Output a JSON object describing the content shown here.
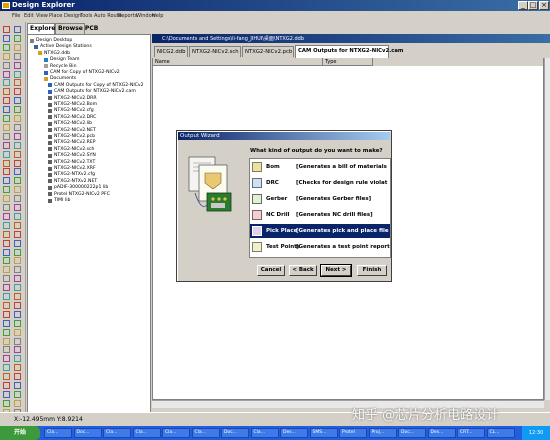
{
  "window": {
    "title": "Design Explorer"
  },
  "menu": [
    "File",
    "Edit",
    "View",
    "Place",
    "Design",
    "Tools",
    "Auto Route",
    "Reports",
    "Window",
    "Help"
  ],
  "explorer": {
    "tabs": [
      "Explorer",
      "Browse PCB"
    ],
    "tree": [
      "Design Desktop",
      "Active Design Stations",
      "NTXG2.ddb",
      "Design Team",
      "Recycle Bin",
      "CAM for Copy of NTXG2-NICv2",
      "Documents",
      "CAM Outputs for Copy of NTXG2-NICv2",
      "CAM Outputs for NTXG2-NICv2.cam",
      "NTXG2-NICv2.DRR",
      "NTXG2-NICv2.Bom",
      "NTXG2-NICv2.cfg",
      "NTXG2-NICv2.DRC",
      "NTXG2-NICv2.lib",
      "NTXG2-NICv2.NET",
      "NTXG2-NICv2.pcb",
      "NTXG2-NICv2.REP",
      "NTXG2-NICv2.sch",
      "NTXG2-NICv2.SYN",
      "NTXG2-NICv2.TXT",
      "NTXG2-NICv2.XRF",
      "NTXG2-NTXv2.cfg",
      "NTXG2-NTXv2.NET",
      "pADIF-300000222p1 lib",
      "Protel NTXG2-NICv2 PFC",
      "TIMI lib"
    ]
  },
  "document": {
    "path": "C:\\Documents and Settings\\li-fang_JIHUI\\桌面\\NTXG2.ddb",
    "tabs": [
      "NICG2.ddb",
      "NTXG2-NICv2.sch",
      "NTXG2-NICv2.pcb",
      "CAM Outputs for NTXG2-NICv2.cam"
    ],
    "columns": [
      "Name",
      "Type"
    ]
  },
  "dialog": {
    "title": "Output Wizard",
    "question": "What kind of output do you want to make?",
    "options": [
      {
        "label": "Bom",
        "desc": "[Generates a bill of materials",
        "icon_color": "#f0e0a0",
        "selected": false
      },
      {
        "label": "DRC",
        "desc": "[Checks for design rule violat",
        "icon_color": "#d0e0f0",
        "selected": false
      },
      {
        "label": "Gerber",
        "desc": "[Generates Gerber files]",
        "icon_color": "#e0f0d0",
        "selected": false
      },
      {
        "label": "NC Drill",
        "desc": "[Generates NC drill files]",
        "icon_color": "#f0d0d0",
        "selected": false
      },
      {
        "label": "Pick Place",
        "desc": "[Generates pick and place file",
        "icon_color": "#e0d0f0",
        "selected": true
      },
      {
        "label": "Test Points",
        "desc": "[Generates a test point report",
        "icon_color": "#f0f0d0",
        "selected": false
      }
    ],
    "buttons": {
      "cancel": "Cancel",
      "back": "< Back",
      "next": "Next >",
      "finish": "Finish"
    }
  },
  "status": {
    "coords": "X:-12.495mm Y:8.9214"
  },
  "taskbar": {
    "start": "开始",
    "items": [
      "Cla...",
      "Doc...",
      "Cla...",
      "Cla...",
      "Cla...",
      "Cla...",
      "Doc...",
      "Cla...",
      "Des...",
      "SMS...",
      "Protel",
      "Proj...",
      "Doc...",
      "Des...",
      "CRT...",
      "CL..."
    ],
    "clock": "12:30"
  },
  "watermark": "知乎 @芯片分析电路设计",
  "colors": {
    "selection": "#0a246a",
    "titlebar": "#0a246a",
    "taskbar": "#245edb"
  }
}
